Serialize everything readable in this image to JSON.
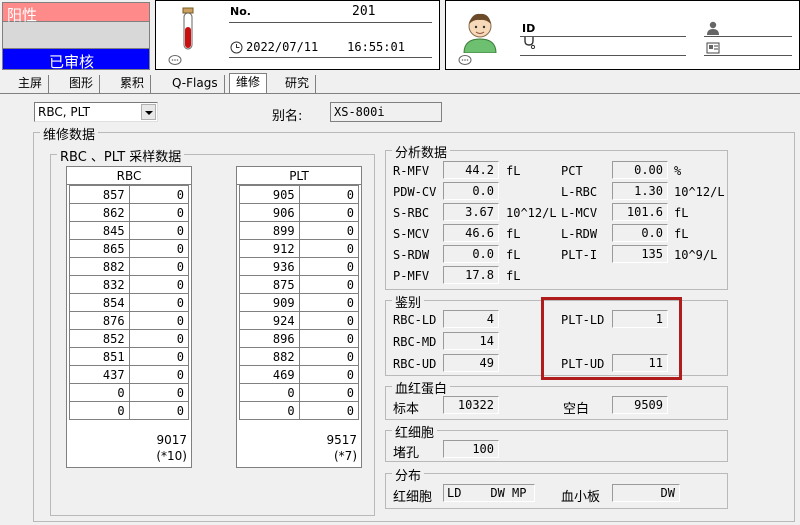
{
  "status": {
    "result": "阳性",
    "review": "已审核"
  },
  "sample": {
    "no_label": "No.",
    "no_value": "201",
    "datetime": "2022/07/11    16:55:01"
  },
  "patient": {
    "id_label": "ID"
  },
  "tabs": [
    {
      "label": "主屏",
      "active": false
    },
    {
      "label": "图形",
      "active": false
    },
    {
      "label": "累积",
      "active": false
    },
    {
      "label": "Q-Flags",
      "active": false
    },
    {
      "label": "维修",
      "active": true
    },
    {
      "label": "研究",
      "active": false
    }
  ],
  "controls": {
    "select_value": "RBC, PLT",
    "alias_label": "别名:",
    "alias_value": "XS-800i"
  },
  "maintenance": {
    "title": "维修数据",
    "sample_title": "RBC 、PLT 采样数据",
    "rbc": {
      "header": "RBC",
      "rows": [
        [
          "857",
          "0"
        ],
        [
          "862",
          "0"
        ],
        [
          "845",
          "0"
        ],
        [
          "865",
          "0"
        ],
        [
          "882",
          "0"
        ],
        [
          "832",
          "0"
        ],
        [
          "854",
          "0"
        ],
        [
          "876",
          "0"
        ],
        [
          "852",
          "0"
        ],
        [
          "851",
          "0"
        ],
        [
          "437",
          "0"
        ],
        [
          "0",
          "0"
        ],
        [
          "0",
          "0"
        ]
      ],
      "total": "9017",
      "mult": "(*10)"
    },
    "plt": {
      "header": "PLT",
      "rows": [
        [
          "905",
          "0"
        ],
        [
          "906",
          "0"
        ],
        [
          "899",
          "0"
        ],
        [
          "912",
          "0"
        ],
        [
          "936",
          "0"
        ],
        [
          "875",
          "0"
        ],
        [
          "909",
          "0"
        ],
        [
          "924",
          "0"
        ],
        [
          "896",
          "0"
        ],
        [
          "882",
          "0"
        ],
        [
          "469",
          "0"
        ],
        [
          "0",
          "0"
        ],
        [
          "0",
          "0"
        ]
      ],
      "total": "9517",
      "mult": "(*7)"
    }
  },
  "analysis": {
    "title": "分析数据",
    "left": [
      {
        "label": "R-MFV",
        "value": "44.2",
        "unit": "fL"
      },
      {
        "label": "PDW-CV",
        "value": "0.0",
        "unit": ""
      },
      {
        "label": "S-RBC",
        "value": "3.67",
        "unit": "10^12/L"
      },
      {
        "label": "S-MCV",
        "value": "46.6",
        "unit": "fL"
      },
      {
        "label": "S-RDW",
        "value": "0.0",
        "unit": "fL"
      },
      {
        "label": "P-MFV",
        "value": "17.8",
        "unit": "fL"
      }
    ],
    "right": [
      {
        "label": "PCT",
        "value": "0.00",
        "unit": "%"
      },
      {
        "label": "L-RBC",
        "value": "1.30",
        "unit": "10^12/L"
      },
      {
        "label": "L-MCV",
        "value": "101.6",
        "unit": "fL"
      },
      {
        "label": "L-RDW",
        "value": "0.0",
        "unit": "fL"
      },
      {
        "label": "PLT-I",
        "value": "135",
        "unit": "10^9/L"
      }
    ]
  },
  "identify": {
    "title": "鉴别",
    "rbc_ld_label": "RBC-LD",
    "rbc_ld": "4",
    "rbc_md_label": "RBC-MD",
    "rbc_md": "14",
    "rbc_ud_label": "RBC-UD",
    "rbc_ud": "49",
    "plt_ld_label": "PLT-LD",
    "plt_ld": "1",
    "plt_ud_label": "PLT-UD",
    "plt_ud": "11",
    "highlight_color": "#b01c1c"
  },
  "hemoglobin": {
    "title": "血红蛋白",
    "std_label": "标本",
    "std_value": "10322",
    "blank_label": "空白",
    "blank_value": "9509"
  },
  "rbc_cell": {
    "title": "红细胞",
    "hole_label": "堵孔",
    "hole_value": "100"
  },
  "distribution": {
    "title": "分布",
    "rbc_label": "红细胞",
    "rbc_value": "LD    DW MP",
    "plt_label": "血小板",
    "plt_value": "DW"
  },
  "colors": {
    "positive_bg": "#ff8a8a",
    "reviewed_bg": "#0000ff"
  }
}
